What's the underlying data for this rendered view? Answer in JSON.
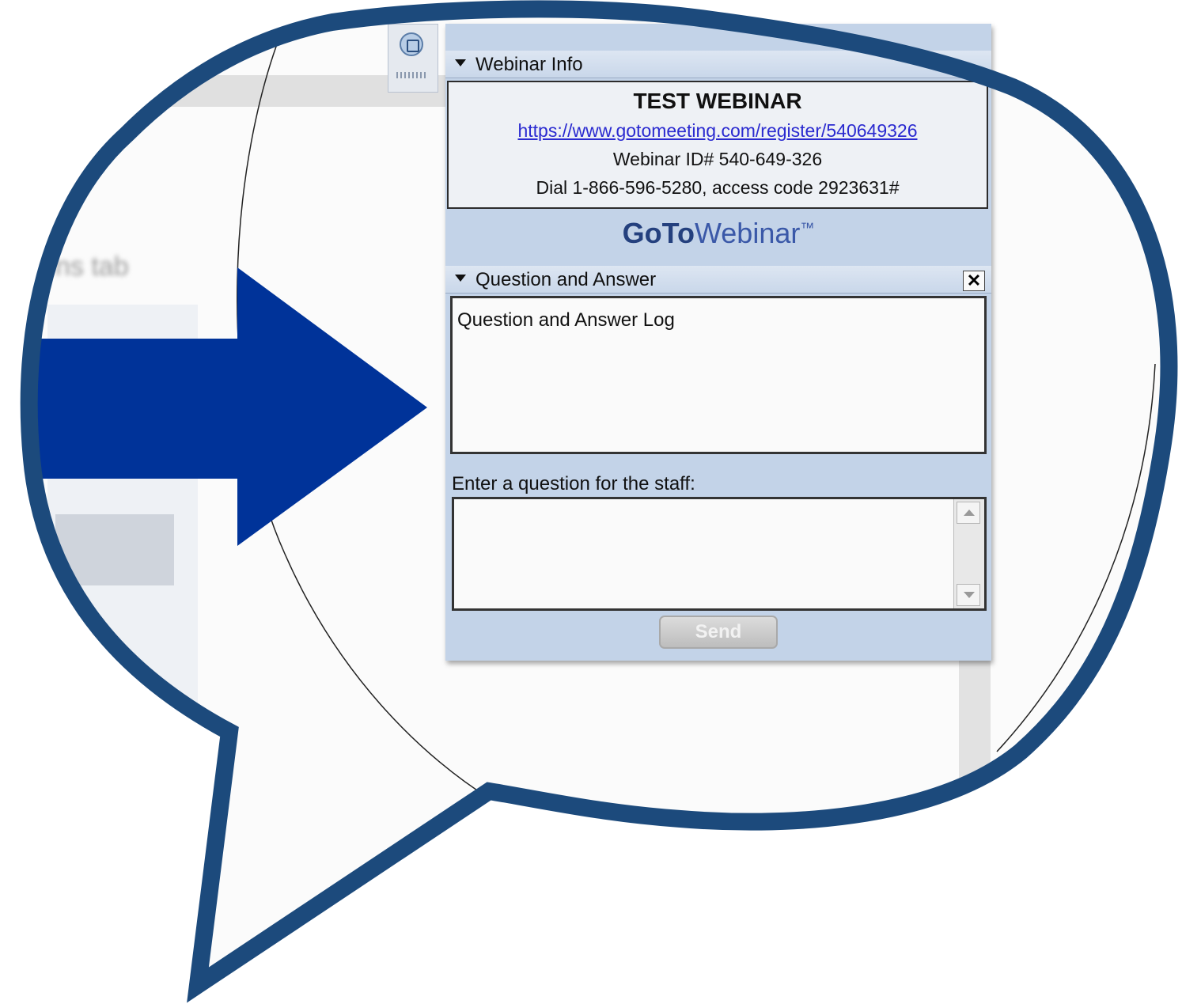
{
  "colors": {
    "bubble_border": "#1c4a7c",
    "arrow": "#003399",
    "panel_bg": "#c3d3e8",
    "link": "#2a2ad0"
  },
  "background_app": {
    "partial_title": "ns tab"
  },
  "webinar_info": {
    "header": "Webinar Info",
    "title": "TEST WEBINAR",
    "url": "https://www.gotomeeting.com/register/540649326",
    "webinar_id": "Webinar ID# 540-649-326",
    "dial_in": "Dial 1-866-596-5280, access code 2923631#"
  },
  "brand": {
    "go": "GoTo",
    "webinar": "Webinar",
    "tm": "™"
  },
  "qa": {
    "header": "Question and Answer",
    "close_label": "✕",
    "log_text": "Question and Answer Log",
    "prompt": "Enter a question for the staff:",
    "input_value": "",
    "send_label": "Send"
  },
  "icons": [
    "toolbar-window-icon",
    "collapse-triangle-icon",
    "close-icon",
    "scroll-up-icon",
    "scroll-down-icon",
    "pointer-arrow-icon"
  ]
}
